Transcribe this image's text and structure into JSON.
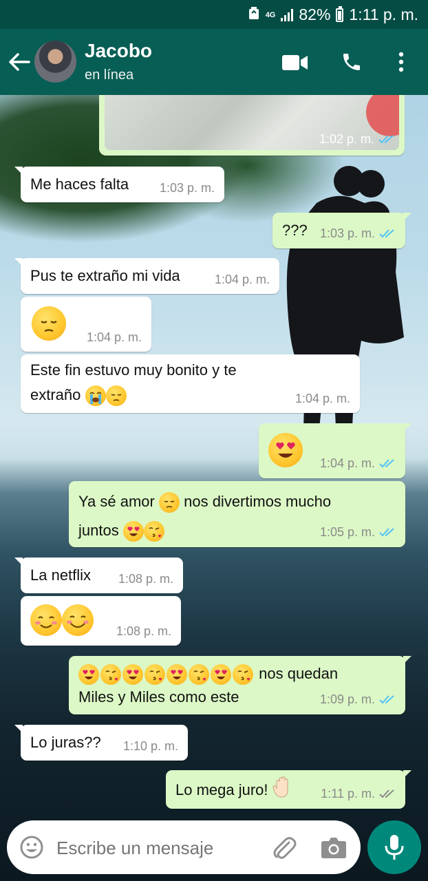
{
  "status_bar": {
    "network": "4G",
    "battery": "82%",
    "time": "1:11 p. m."
  },
  "header": {
    "contact_name": "Jacobo",
    "status": "en línea"
  },
  "messages": [
    {
      "dir": "out",
      "text": "",
      "time": "1:02 p. m.",
      "ticks": "read"
    },
    {
      "dir": "in",
      "text": "Me haces falta",
      "time": "1:03 p. m."
    },
    {
      "dir": "out",
      "text": "???",
      "time": "1:03 p. m.",
      "ticks": "read"
    },
    {
      "dir": "in",
      "text": "Pus te extraño mi vida",
      "time": "1:04 p. m."
    },
    {
      "dir": "in",
      "text": "",
      "emoji": [
        "pensive-face"
      ],
      "time": "1:04 p. m."
    },
    {
      "dir": "in",
      "line1": "Este fin estuvo muy bonito y te",
      "line2": "extraño",
      "emoji": [
        "loudly-crying-face",
        "pensive-face"
      ],
      "time": "1:04 p. m."
    },
    {
      "dir": "out",
      "text": "",
      "emoji": [
        "heart-eyes-face"
      ],
      "time": "1:04 p. m.",
      "ticks": "read"
    },
    {
      "dir": "out",
      "part1": "Ya sé amor",
      "part2": "nos divertimos mucho",
      "line2": "juntos",
      "emoji": [
        "pensive-face",
        "heart-eyes-face",
        "kissing-heart-face"
      ],
      "time": "1:05 p. m.",
      "ticks": "read"
    },
    {
      "dir": "in",
      "text": "La netflix",
      "time": "1:08 p. m."
    },
    {
      "dir": "in",
      "text": "",
      "emoji": [
        "smiling-face",
        "blushing-face"
      ],
      "time": "1:08 p. m."
    },
    {
      "dir": "out",
      "part2": "nos quedan",
      "line2": "Miles y Miles como este",
      "emoji": [
        "heart-eyes-face",
        "kissing-heart-face",
        "heart-eyes-face",
        "kissing-heart-face",
        "heart-eyes-face",
        "kissing-heart-face",
        "heart-eyes-face",
        "kissing-heart-face"
      ],
      "time": "1:09 p. m.",
      "ticks": "read"
    },
    {
      "dir": "in",
      "text": "Lo juras??",
      "time": "1:10 p. m."
    },
    {
      "dir": "out",
      "text": "Lo mega juro!",
      "emoji": [
        "raised-hand"
      ],
      "time": "1:11 p. m.",
      "ticks": "delivered"
    }
  ],
  "input": {
    "placeholder": "Escribe un mensaje"
  },
  "colors": {
    "header": "#075e54",
    "statusbar": "#054d44",
    "outgoing": "#dcf8c6",
    "incoming": "#ffffff",
    "read_ticks": "#4fc3f7",
    "mic_button": "#00897b"
  },
  "icons": [
    "back-arrow-icon",
    "video-call-icon",
    "phone-icon",
    "menu-dots-icon",
    "emoji-icon",
    "attach-icon",
    "camera-icon",
    "mic-icon"
  ]
}
